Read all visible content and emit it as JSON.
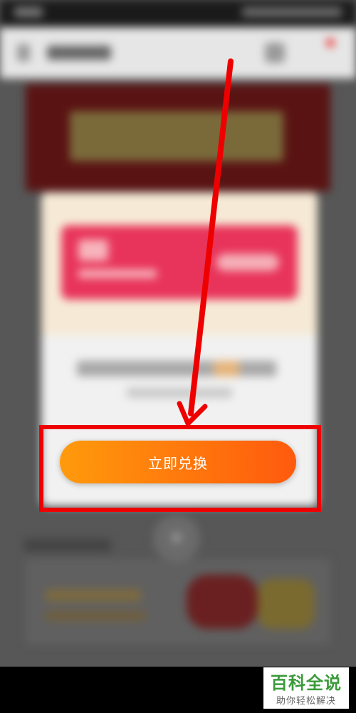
{
  "redeem_button": {
    "label": "立即兑换"
  },
  "watermark": {
    "title": "百科全说",
    "subtitle": "助你轻松解决"
  },
  "colors": {
    "highlight": "#ee0000",
    "button_gradient_start": "#ff9a0c",
    "button_gradient_end": "#ff5a0d",
    "coupon": "#e8345a",
    "watermark_green": "#3a9a3a"
  },
  "icons": [
    "back-arrow-icon",
    "cart-icon",
    "close-icon",
    "annotation-arrow"
  ]
}
